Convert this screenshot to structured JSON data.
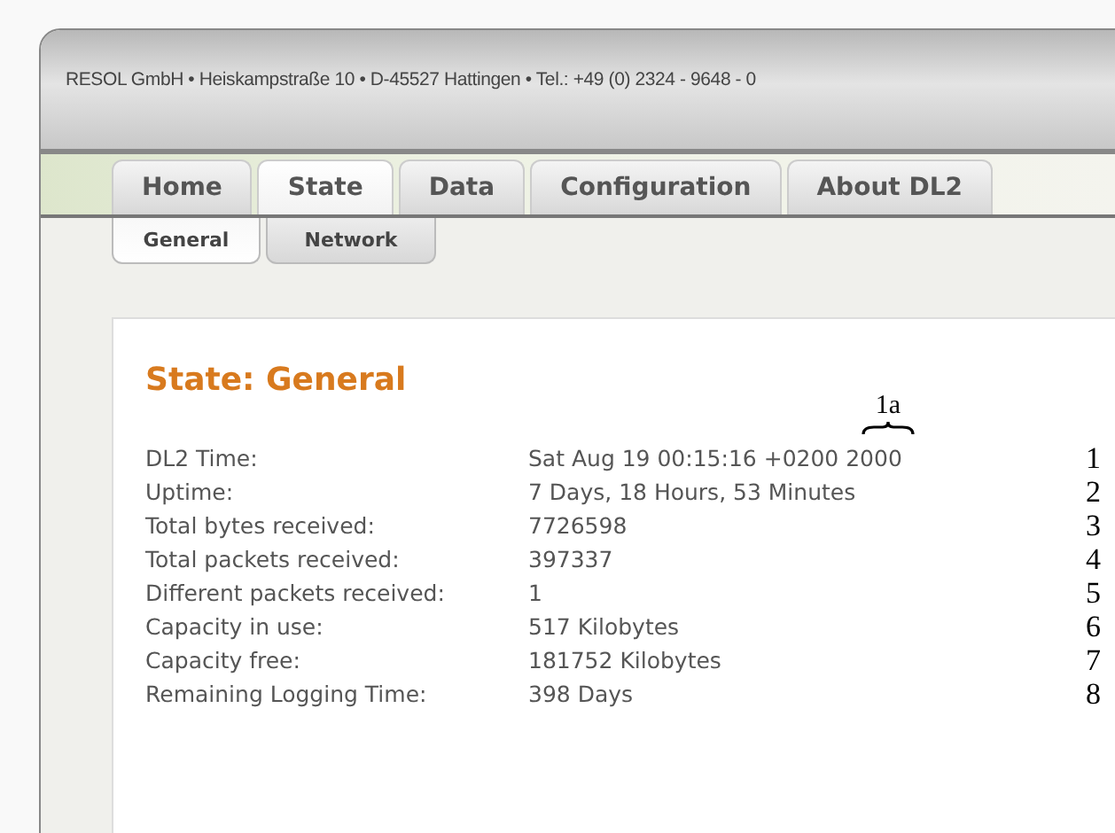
{
  "header": {
    "address": "RESOL GmbH • Heiskampstraße 10 • D-45527 Hattingen • Tel.: +49 (0) 2324 - 9648 - 0"
  },
  "tabs": [
    {
      "label": "Home",
      "selected": false
    },
    {
      "label": "State",
      "selected": true
    },
    {
      "label": "Data",
      "selected": false
    },
    {
      "label": "Configuration",
      "selected": false
    },
    {
      "label": "About DL2",
      "selected": false
    }
  ],
  "subtabs": [
    {
      "label": "General",
      "selected": true
    },
    {
      "label": "Network",
      "selected": false
    }
  ],
  "panel": {
    "title": "State: General",
    "annotation": "1a",
    "rows": [
      {
        "label": "DL2 Time:",
        "value": "Sat Aug 19 00:15:16 +0200 2000",
        "marker": "1"
      },
      {
        "label": "Uptime:",
        "value": "7 Days, 18 Hours, 53 Minutes",
        "marker": "2"
      },
      {
        "label": "Total bytes received:",
        "value": "7726598",
        "marker": "3"
      },
      {
        "label": "Total packets received:",
        "value": "397337",
        "marker": "4"
      },
      {
        "label": "Different packets received:",
        "value": "1",
        "marker": "5"
      },
      {
        "label": "Capacity in use:",
        "value": "517 Kilobytes",
        "marker": "6"
      },
      {
        "label": "Capacity free:",
        "value": "181752 Kilobytes",
        "marker": "7"
      },
      {
        "label": "Remaining Logging Time:",
        "value": "398 Days",
        "marker": "8"
      }
    ]
  }
}
